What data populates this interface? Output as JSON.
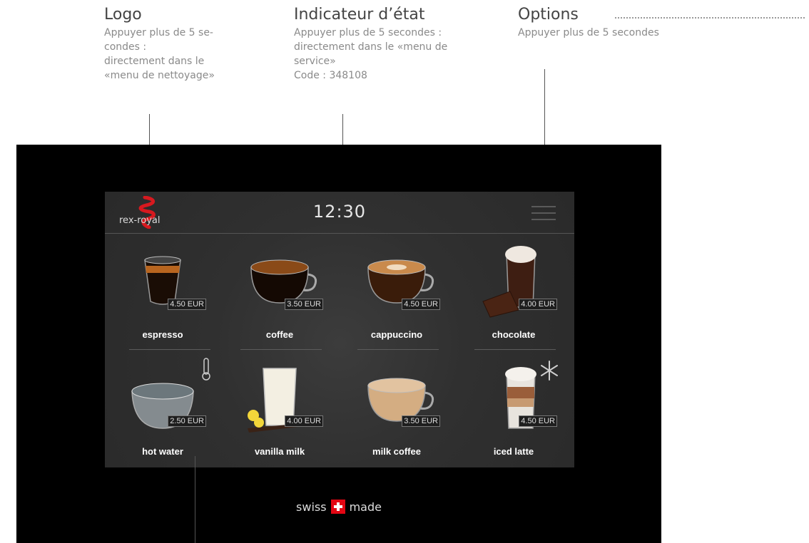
{
  "annotations": {
    "logo": {
      "title": "Logo",
      "desc": "Appuyer plus de 5 se-\ncondes :\ndirectement dans le\n«menu de nettoyage»"
    },
    "status": {
      "title": "Indicateur d’état",
      "desc": "Appuyer plus de 5 secondes :\ndirectement dans le «menu de\nservice»\nCode : 348108"
    },
    "options": {
      "title": "Options",
      "desc": "Appuyer plus de 5 secondes"
    }
  },
  "screen": {
    "logo_text": "rex-royal",
    "clock": "12:30",
    "products": [
      {
        "label": "espresso",
        "price": "4.50 EUR",
        "icon": "espresso-glass-icon"
      },
      {
        "label": "coffee",
        "price": "3.50 EUR",
        "icon": "coffee-cup-icon"
      },
      {
        "label": "cappuccino",
        "price": "4.50 EUR",
        "icon": "cappuccino-cup-icon"
      },
      {
        "label": "chocolate",
        "price": "4.00 EUR",
        "icon": "chocolate-glass-icon"
      },
      {
        "label": "hot water",
        "price": "2.50 EUR",
        "icon": "hot-water-bowl-icon"
      },
      {
        "label": "vanilla milk",
        "price": "4.00 EUR",
        "icon": "vanilla-milk-glass-icon"
      },
      {
        "label": "milk coffee",
        "price": "3.50 EUR",
        "icon": "milk-coffee-cup-icon"
      },
      {
        "label": "iced latte",
        "price": "4.50 EUR",
        "icon": "iced-latte-glass-icon"
      }
    ],
    "badges": {
      "hot_water": "thermometer-icon",
      "iced_latte": "snowflake-icon"
    }
  },
  "footer": {
    "swiss": "swiss",
    "made": "made"
  },
  "colors": {
    "device": "#000000",
    "screen": "#303030",
    "logo_red": "#d7191f",
    "flag_red": "#e30613"
  }
}
